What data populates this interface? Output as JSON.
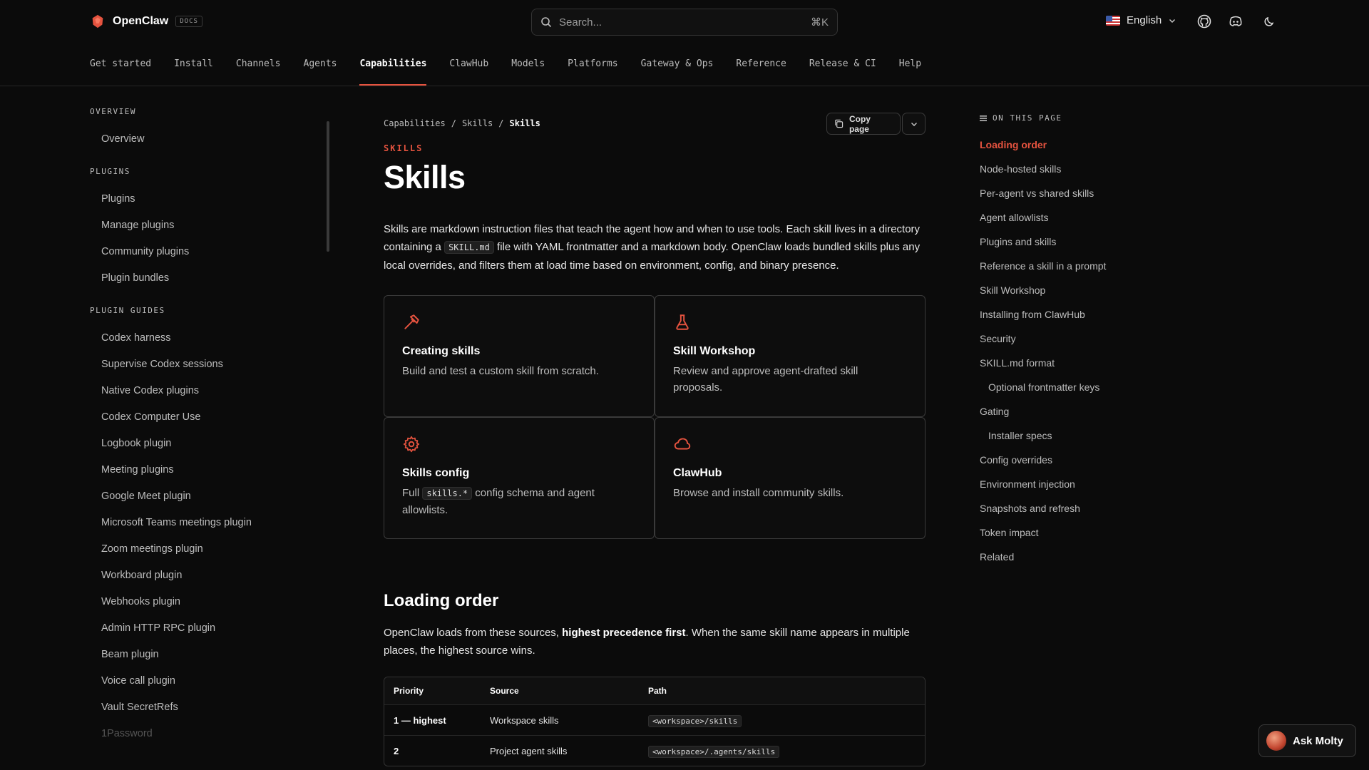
{
  "colors": {
    "accent": "#e5533f",
    "background": "#0b0b0b"
  },
  "header": {
    "brand_name": "OpenClaw",
    "brand_badge": "DOCS",
    "search_placeholder": "Search...",
    "search_shortcut": "⌘K",
    "language": "English",
    "icons": [
      "github-icon",
      "discord-icon",
      "moon-icon"
    ]
  },
  "nav": {
    "tabs": [
      "Get started",
      "Install",
      "Channels",
      "Agents",
      "Capabilities",
      "ClawHub",
      "Models",
      "Platforms",
      "Gateway & Ops",
      "Reference",
      "Release & CI",
      "Help"
    ],
    "active": "Capabilities"
  },
  "sidebar": {
    "groups": [
      {
        "title": "OVERVIEW",
        "items": [
          "Overview"
        ]
      },
      {
        "title": "PLUGINS",
        "items": [
          "Plugins",
          "Manage plugins",
          "Community plugins",
          "Plugin bundles"
        ]
      },
      {
        "title": "PLUGIN GUIDES",
        "items": [
          "Codex harness",
          "Supervise Codex sessions",
          "Native Codex plugins",
          "Codex Computer Use",
          "Logbook plugin",
          "Meeting plugins",
          "Google Meet plugin",
          "Microsoft Teams meetings plugin",
          "Zoom meetings plugin",
          "Workboard plugin",
          "Webhooks plugin",
          "Admin HTTP RPC plugin",
          "Beam plugin",
          "Voice call plugin",
          "Vault SecretRefs",
          "1Password"
        ]
      }
    ]
  },
  "main": {
    "breadcrumb": [
      "Capabilities",
      "/",
      "Skills",
      "/",
      "Skills"
    ],
    "copy_page_label": "Copy page",
    "eyebrow": "SKILLS",
    "title": "Skills",
    "intro_1": "Skills are markdown instruction files that teach the agent how and when to use tools. Each skill lives in a directory containing a ",
    "intro_code": "SKILL.md",
    "intro_2": " file with YAML frontmatter and a markdown body. OpenClaw loads bundled skills plus any local overrides, and filters them at load time based on environment, config, and binary presence.",
    "cards": [
      {
        "icon": "hammer-icon",
        "title": "Creating skills",
        "desc_pre": "Build and test a custom skill from scratch.",
        "code": "",
        "desc_post": ""
      },
      {
        "icon": "flask-icon",
        "title": "Skill Workshop",
        "desc_pre": "Review and approve agent-drafted skill proposals.",
        "code": "",
        "desc_post": ""
      },
      {
        "icon": "gear-icon",
        "title": "Skills config",
        "desc_pre": "Full ",
        "code": "skills.*",
        "desc_post": " config schema and agent allowlists."
      },
      {
        "icon": "cloud-icon",
        "title": "ClawHub",
        "desc_pre": "Browse and install community skills.",
        "code": "",
        "desc_post": ""
      }
    ],
    "loading_order_title": "Loading order",
    "loading_order_p1": "OpenClaw loads from these sources, ",
    "loading_order_bold": "highest precedence first",
    "loading_order_p2": ". When the same skill name appears in multiple places, the highest source wins.",
    "table": {
      "headers": [
        "Priority",
        "Source",
        "Path"
      ],
      "rows": [
        {
          "priority": "1 — highest",
          "source": "Workspace skills",
          "path": "<workspace>/skills"
        },
        {
          "priority": "2",
          "source": "Project agent skills",
          "path": "<workspace>/.agents/skills"
        }
      ]
    }
  },
  "toc": {
    "heading": "ON THIS PAGE",
    "items": [
      {
        "label": "Loading order",
        "active": true,
        "sub": false
      },
      {
        "label": "Node-hosted skills",
        "active": false,
        "sub": false
      },
      {
        "label": "Per-agent vs shared skills",
        "active": false,
        "sub": false
      },
      {
        "label": "Agent allowlists",
        "active": false,
        "sub": false
      },
      {
        "label": "Plugins and skills",
        "active": false,
        "sub": false
      },
      {
        "label": "Reference a skill in a prompt",
        "active": false,
        "sub": false
      },
      {
        "label": "Skill Workshop",
        "active": false,
        "sub": false
      },
      {
        "label": "Installing from ClawHub",
        "active": false,
        "sub": false
      },
      {
        "label": "Security",
        "active": false,
        "sub": false
      },
      {
        "label": "SKILL.md format",
        "active": false,
        "sub": false
      },
      {
        "label": "Optional frontmatter keys",
        "active": false,
        "sub": true
      },
      {
        "label": "Gating",
        "active": false,
        "sub": false
      },
      {
        "label": "Installer specs",
        "active": false,
        "sub": true
      },
      {
        "label": "Config overrides",
        "active": false,
        "sub": false
      },
      {
        "label": "Environment injection",
        "active": false,
        "sub": false
      },
      {
        "label": "Snapshots and refresh",
        "active": false,
        "sub": false
      },
      {
        "label": "Token impact",
        "active": false,
        "sub": false
      },
      {
        "label": "Related",
        "active": false,
        "sub": false
      }
    ]
  },
  "ask": {
    "label": "Ask Molty"
  }
}
